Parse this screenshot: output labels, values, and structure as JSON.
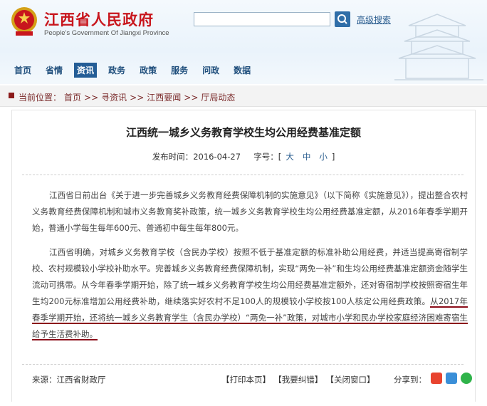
{
  "header": {
    "title": "江西省人民政府",
    "subtitle": "People's Government Of Jiangxi Province",
    "advanced_search": "高级搜索"
  },
  "nav": [
    "首页",
    "省情",
    "资讯",
    "政务",
    "政策",
    "服务",
    "问政",
    "数据"
  ],
  "breadcrumb": {
    "prefix": "当前位置：",
    "items": [
      "首页",
      ">>",
      "寻资讯",
      ">>",
      "江西要闻",
      ">>",
      "厅局动态"
    ]
  },
  "article": {
    "title": "江西统一城乡义务教育学校生均公用经费基准定额",
    "publish_label": "发布时间：",
    "publish_date": "2016-04-27",
    "fontsize_label": "字号：[",
    "font_large": "大",
    "font_medium": "中",
    "font_small": "小",
    "fontsize_close": "]",
    "para1": "江西省日前出台《关于进一步完善城乡义务教育经费保障机制的实施意见》（以下简称《实施意见》），提出整合农村义务教育经费保障机制和城市义务教育奖补政策，统一城乡义务教育学校生均公用经费基准定额，从2016年春季学期开始，普通小学每生每年600元、普通初中每生每年800元。",
    "para2_a": "江西省明确，对城乡义务教育学校（含民办学校）按照不低于基准定额的标准补助公用经费，并适当提高寄宿制学校、农村规模较小学校补助水平。完善城乡义务教育经费保障机制，实现“两免一补”和生均公用经费基准定额资金随学生流动可携带。从今年春季学期开始，除了统一城乡义务教育学校生均公用经费基准定额外，还对寄宿制学校按照寄宿生年生均200元标准增加公用经费补助，继续落实好农村不足100人的规模较小学校按100人核定公用经费政策。",
    "para2_b": "从2017年春季学期开始，还将统一城乡义务教育学生（含民办学校）“两免一补”政策，对城市小学和民办学校家庭经济困难寄宿生给予生活费补助。",
    "source": "来源：江西省财政厅",
    "print": "【打印本页】",
    "correct": "【我要纠错】",
    "close": "【关闭窗口】",
    "share": "分享到："
  },
  "icons": [
    "emblem-icon",
    "search-icon",
    "weibo-icon",
    "qq-icon",
    "wechat-icon"
  ],
  "colors": {
    "brand_red": "#c8161d",
    "nav_blue": "#1f4e7c",
    "underline": "#8b0d1a"
  }
}
